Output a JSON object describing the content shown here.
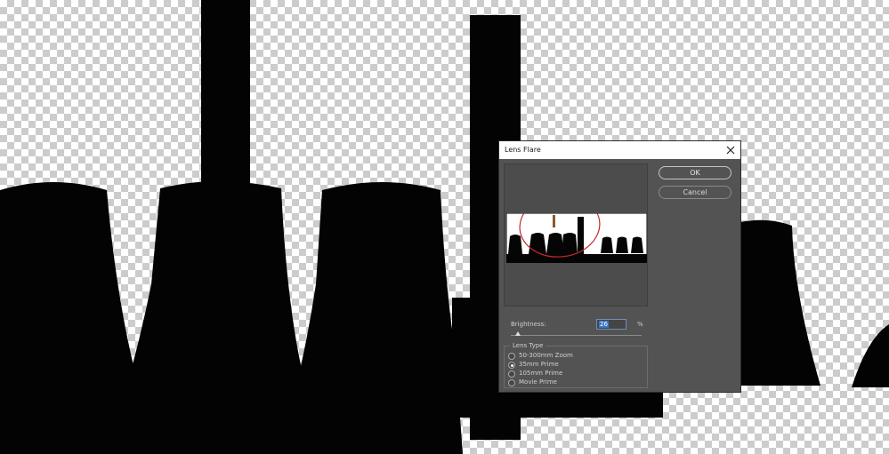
{
  "dialog": {
    "title": "Lens Flare",
    "ok_label": "OK",
    "cancel_label": "Cancel",
    "brightness_label": "Brightness:",
    "brightness_value": "26",
    "percent_sign": "%",
    "brightness_fraction": 0.26,
    "lens_type_label": "Lens Type",
    "lens_options": [
      {
        "label": "50-300mm Zoom",
        "checked": false
      },
      {
        "label": "35mm Prime",
        "checked": true
      },
      {
        "label": "105mm Prime",
        "checked": false
      },
      {
        "label": "Movie Prime",
        "checked": false
      }
    ]
  },
  "icons": {
    "close": "close-icon"
  },
  "colors": {
    "dialog_bg": "#535353",
    "silhouette": "#030303",
    "highlight_circle": "#c1272d"
  }
}
